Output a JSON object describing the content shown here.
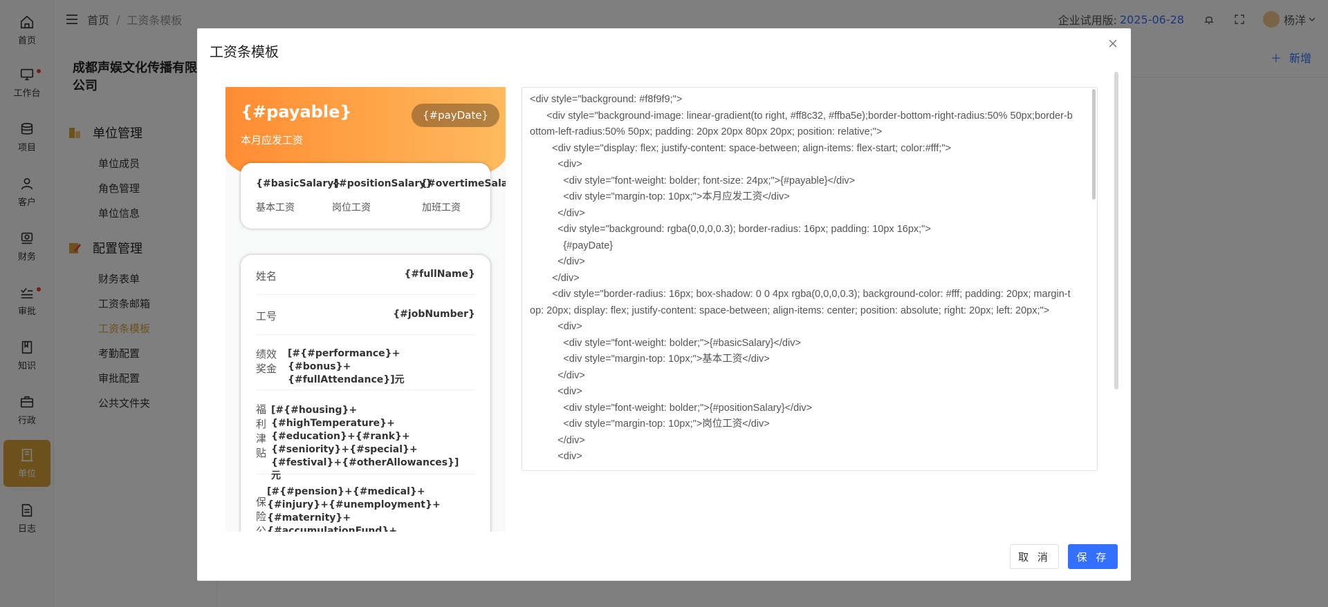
{
  "rail": [
    {
      "key": "home",
      "label": "首页",
      "icon": "home-icon"
    },
    {
      "key": "workbench",
      "label": "工作台",
      "icon": "monitor-icon",
      "dot": true
    },
    {
      "key": "project",
      "label": "项目",
      "icon": "database-icon"
    },
    {
      "key": "customer",
      "label": "客户",
      "icon": "user-icon"
    },
    {
      "key": "finance",
      "label": "财务",
      "icon": "finance-icon"
    },
    {
      "key": "approval",
      "label": "审批",
      "icon": "checklist-icon",
      "dot": true
    },
    {
      "key": "knowledge",
      "label": "知识",
      "icon": "book-icon"
    },
    {
      "key": "admin",
      "label": "行政",
      "icon": "briefcase-icon"
    },
    {
      "key": "unit",
      "label": "单位",
      "icon": "building-icon",
      "active": true
    },
    {
      "key": "log",
      "label": "日志",
      "icon": "document-icon"
    }
  ],
  "breadcrumb": {
    "home": "首页",
    "sep": "/",
    "current": "工资条模板"
  },
  "topbar": {
    "trial_label": "企业试用版:",
    "trial_date": "2025-06-28",
    "user_name": "杨洋"
  },
  "sidebar": {
    "company": "成都声娱文化传播有限公司",
    "groups": [
      {
        "title": "单位管理",
        "items": [
          "单位成员",
          "角色管理",
          "单位信息"
        ]
      },
      {
        "title": "配置管理",
        "items": [
          "财务表单",
          "工资条邮箱",
          "工资条模板",
          "考勤配置",
          "审批配置",
          "公共文件夹"
        ]
      }
    ],
    "active_item": "工资条模板"
  },
  "content": {
    "add_label": "新增"
  },
  "modal": {
    "title": "工资条模板",
    "cancel_label": "取 消",
    "save_label": "保 存",
    "preview": {
      "payable": "{#payable}",
      "payable_label": "本月应发工资",
      "pay_date": "{#payDate}",
      "salary_values": [
        "{#basicSalary}",
        "{#positionSalary}",
        "{#overtimeSalary}"
      ],
      "salary_labels": [
        "基本工资",
        "岗位工资",
        "加班工资"
      ],
      "rows": [
        {
          "label": "姓名",
          "value": "{#fullName}"
        },
        {
          "label": "工号",
          "value": "{#jobNumber}"
        }
      ],
      "performance_label": "绩效奖金",
      "performance_value": "[#{#performance}+{#bonus}+{#fullAttendance}]元",
      "welfare_label": "福利津贴",
      "welfare_value": "[#{#housing}+{#highTemperature}+{#education}+{#rank}+{#seniority}+{#special}+{#festival}+{#otherAllowances}] 元",
      "insurance_label": "保险公",
      "insurance_value": "[#{#pension}+{#medical}+{#injury}+{#unemployment}+{#maternity}+{#accumulationFund}+{#medicalAdd}+{#accumulationFundAdd}+"
    },
    "code": "<div style=\"background: #f8f9f9;\">\n      <div style=\"background-image: linear-gradient(to right, #ff8c32, #ffba5e);border-bottom-right-radius:50% 50px;border-bottom-left-radius:50% 50px; padding: 20px 20px 80px 20px; position: relative;\">\n        <div style=\"display: flex; justify-content: space-between; align-items: flex-start; color:#fff;\">\n          <div>\n            <div style=\"font-weight: bolder; font-size: 24px;\">{#payable}</div>\n            <div style=\"margin-top: 10px;\">本月应发工资</div>\n          </div>\n          <div style=\"background: rgba(0,0,0,0.3); border-radius: 16px; padding: 10px 16px;\">\n            {#payDate}\n          </div>\n        </div>\n        <div style=\"border-radius: 16px; box-shadow: 0 0 4px rgba(0,0,0,0.3); background-color: #fff; padding: 20px; margin-top: 20px; display: flex; justify-content: space-between; align-items: center; position: absolute; right: 20px; left: 20px;\">\n          <div>\n            <div style=\"font-weight: bolder;\">{#basicSalary}</div>\n            <div style=\"margin-top: 10px;\">基本工资</div>\n          </div>\n          <div>\n            <div style=\"font-weight: bolder;\">{#positionSalary}</div>\n            <div style=\"margin-top: 10px;\">岗位工资</div>\n          </div>\n          <div>"
  }
}
